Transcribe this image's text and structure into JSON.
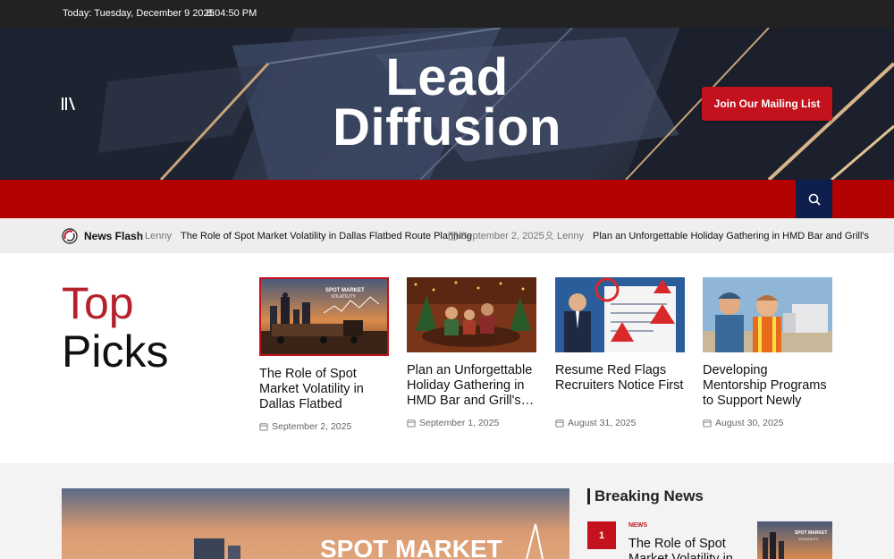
{
  "topbar": {
    "date": "Today: Tuesday, December 9 2025",
    "time": "8:04:50 PM"
  },
  "header": {
    "logo_line1": "Lead",
    "logo_line2": "Diffusion",
    "mailing_button": "Join Our Mailing List"
  },
  "ticker": {
    "label": "News Flash",
    "items": [
      {
        "author": "Lenny",
        "title": "The Role of Spot Market Volatility in Dallas Flatbed Route Planning",
        "date": "September 2, 2025"
      },
      {
        "author": "Lenny",
        "title": "Plan an Unforgettable Holiday Gathering in HMD Bar and Grill's"
      }
    ]
  },
  "top_picks": {
    "heading_line1": "Top",
    "heading_line2": "Picks",
    "cards": [
      {
        "title": "The Role of Spot Market Volatility in Dallas Flatbed Route…",
        "date": "September 2, 2025",
        "image_text_1": "SPOT MARKET",
        "image_text_2": "VOLATILITY"
      },
      {
        "title": "Plan an Unforgettable Holiday Gathering in HMD Bar and Grill's…",
        "date": "September 1, 2025"
      },
      {
        "title": "Resume Red Flags Recruiters Notice First",
        "date": "August 31, 2025"
      },
      {
        "title": "Developing Mentorship Programs to Support Newly Hired Truck…",
        "date": "August 30, 2025"
      }
    ]
  },
  "feature": {
    "image_text": "SPOT MARKET"
  },
  "breaking": {
    "heading": "Breaking News",
    "items": [
      {
        "number": "1",
        "category": "NEWS",
        "title": "The Role of Spot Market Volatility in",
        "image_text_1": "SPOT MARKET",
        "image_text_2": "VOLATILITY"
      }
    ]
  },
  "icons": {
    "menu": "menu-icon",
    "search": "search-icon",
    "flash": "news-flash-icon",
    "calendar": "calendar-icon",
    "user": "user-icon"
  },
  "colors": {
    "accent_red": "#c3111d",
    "nav_red": "#b30000",
    "search_navy": "#0f1f4d",
    "topbar": "#222222"
  }
}
